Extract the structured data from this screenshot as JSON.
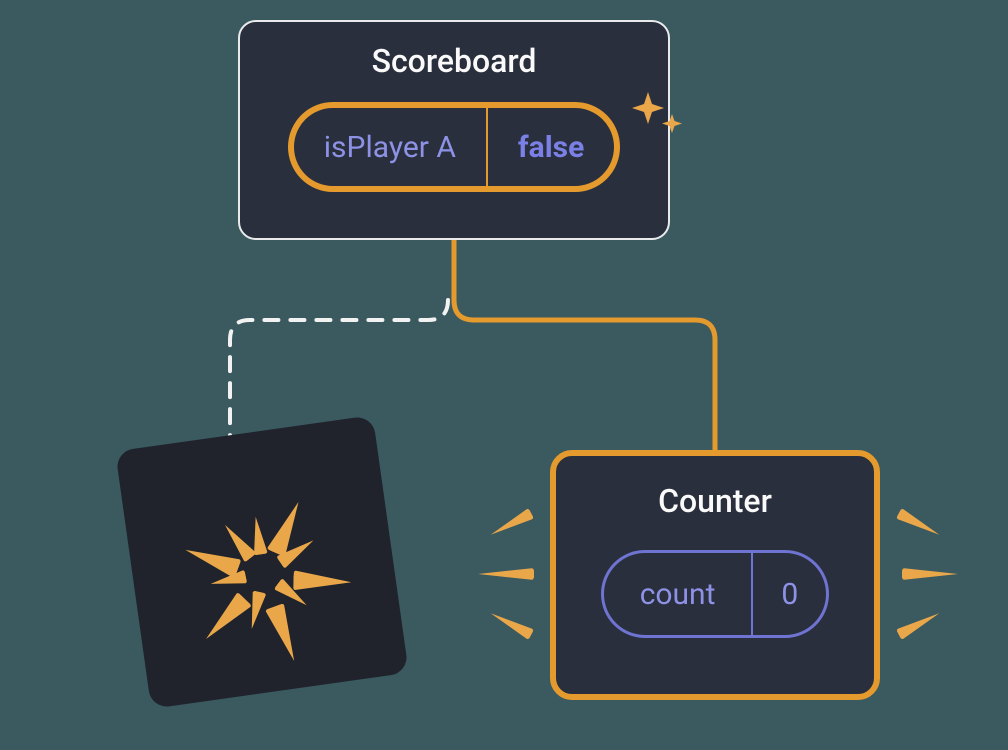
{
  "scoreboard": {
    "title": "Scoreboard",
    "prop_label": "isPlayer A",
    "prop_value": "false"
  },
  "counter": {
    "title": "Counter",
    "state_label": "count",
    "state_value": "0"
  },
  "colors": {
    "highlight": "#e59a2d",
    "text_accent": "#8d92e6",
    "card_bg": "#2a2f3d",
    "dark_bg": "#20232c"
  },
  "diagram": {
    "relation_active": "solid-orange",
    "relation_inactive": "dashed-white"
  }
}
